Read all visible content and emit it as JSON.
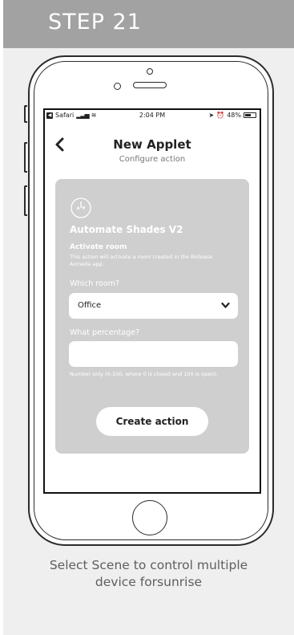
{
  "step": {
    "title": "STEP 21"
  },
  "status_bar": {
    "back_app": "Safari",
    "time": "2:04 PM",
    "battery": "48%"
  },
  "header": {
    "title": "New Applet",
    "subtitle": "Configure action"
  },
  "card": {
    "service_name": "Automate Shades V2",
    "action_name": "Activate room",
    "action_description": "This action will activate a room created in the Rollease Acmeda app.",
    "room_label": "Which room?",
    "room_value": "Office",
    "percentage_label": "What percentage?",
    "percentage_value": "",
    "percentage_hint": "Number only (0-100, where 0 is closed and 100 is open).",
    "create_button": "Create action"
  },
  "caption": {
    "line1": "Select Scene to control multiple",
    "line2": "device forsunrise"
  },
  "colors": {
    "step_header": "#a2a2a2",
    "page_background": "#efefef",
    "card_background": "#cfcfcf"
  }
}
